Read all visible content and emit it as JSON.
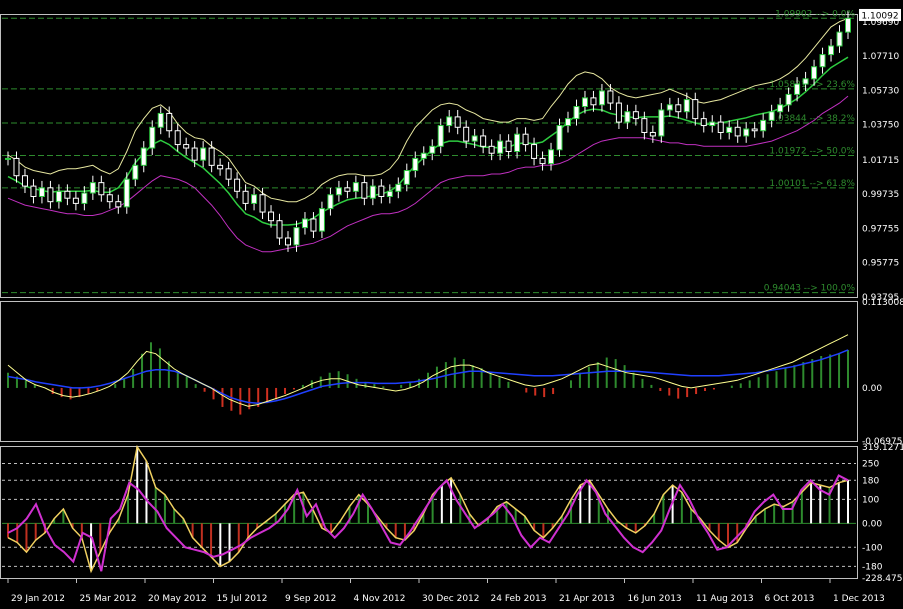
{
  "chart_data": [
    {
      "type": "line",
      "panel": "price",
      "ylim": [
        0.9379,
        1.1009
      ],
      "price_tag": "1.10092",
      "y_ticks": [
        "1.09690",
        "1.07710",
        "1.05730",
        "1.03750",
        "1.01715",
        "0.99735",
        "0.97755",
        "0.95775",
        "0.93795"
      ],
      "y_tick_values": [
        1.0969,
        1.0771,
        1.0573,
        1.0375,
        1.01715,
        0.99735,
        0.97755,
        0.95775,
        0.93795
      ],
      "fib_levels": [
        {
          "label": "1.09902 --> 0.0%",
          "value": 1.09902
        },
        {
          "label": "1.05821 --> 23.6%",
          "value": 1.05821
        },
        {
          "label": "1.03844 --> 38.2%",
          "value": 1.03844
        },
        {
          "label": "1.01972 --> 50.0%",
          "value": 1.01972
        },
        {
          "label": "1.00101 --> 61.8%",
          "value": 1.00101
        },
        {
          "label": "0.94043 --> 100.0%",
          "value": 0.94043
        }
      ],
      "close": [
        1.018,
        1.008,
        1.002,
        0.996,
        1.001,
        0.993,
        0.999,
        0.995,
        0.992,
        0.998,
        1.004,
        0.997,
        0.993,
        0.99,
        1.006,
        1.014,
        1.024,
        1.036,
        1.044,
        1.034,
        1.026,
        1.024,
        1.017,
        1.024,
        1.014,
        1.012,
        1.006,
        0.999,
        0.992,
        0.997,
        0.987,
        0.982,
        0.972,
        0.968,
        0.978,
        0.983,
        0.976,
        0.989,
        0.997,
        1.001,
        0.999,
        1.004,
        0.995,
        1.002,
        0.996,
        0.999,
        1.003,
        1.011,
        1.018,
        1.021,
        1.025,
        1.037,
        1.042,
        1.036,
        1.028,
        1.031,
        1.025,
        1.021,
        1.028,
        1.022,
        1.032,
        1.026,
        1.018,
        1.015,
        1.023,
        1.037,
        1.041,
        1.048,
        1.053,
        1.049,
        1.057,
        1.05,
        1.039,
        1.045,
        1.041,
        1.033,
        1.031,
        1.046,
        1.049,
        1.045,
        1.052,
        1.041,
        1.037,
        1.039,
        1.033,
        1.036,
        1.031,
        1.035,
        1.034,
        1.04,
        1.045,
        1.049,
        1.055,
        1.061,
        1.064,
        1.071,
        1.078,
        1.083,
        1.091,
        1.099
      ],
      "bb_upper": [
        1.02,
        1.017,
        1.013,
        1.011,
        1.01,
        1.009,
        1.011,
        1.012,
        1.012,
        1.013,
        1.014,
        1.011,
        1.009,
        1.012,
        1.022,
        1.034,
        1.041,
        1.047,
        1.049,
        1.045,
        1.038,
        1.033,
        1.03,
        1.029,
        1.025,
        1.022,
        1.018,
        1.011,
        1.004,
        1.002,
        0.998,
        0.995,
        0.994,
        0.993,
        0.993,
        0.995,
        0.998,
        1.003,
        1.006,
        1.008,
        1.009,
        1.009,
        1.008,
        1.008,
        1.009,
        1.012,
        1.018,
        1.028,
        1.036,
        1.041,
        1.046,
        1.049,
        1.05,
        1.049,
        1.046,
        1.044,
        1.041,
        1.04,
        1.039,
        1.039,
        1.041,
        1.041,
        1.04,
        1.041,
        1.048,
        1.054,
        1.061,
        1.066,
        1.068,
        1.067,
        1.064,
        1.059,
        1.056,
        1.054,
        1.053,
        1.054,
        1.055,
        1.056,
        1.058,
        1.056,
        1.054,
        1.051,
        1.05,
        1.051,
        1.052,
        1.054,
        1.056,
        1.058,
        1.06,
        1.061,
        1.062,
        1.064,
        1.067,
        1.071,
        1.076,
        1.082,
        1.088,
        1.094,
        1.097,
        1.099
      ],
      "bb_lower": [
        0.995,
        0.993,
        0.991,
        0.99,
        0.989,
        0.988,
        0.987,
        0.986,
        0.986,
        0.985,
        0.985,
        0.986,
        0.988,
        0.99,
        0.993,
        0.997,
        1.001,
        1.005,
        1.008,
        1.007,
        1.006,
        1.004,
        1.001,
        0.996,
        0.991,
        0.985,
        0.978,
        0.972,
        0.968,
        0.966,
        0.964,
        0.964,
        0.965,
        0.966,
        0.967,
        0.968,
        0.969,
        0.971,
        0.973,
        0.976,
        0.979,
        0.981,
        0.983,
        0.985,
        0.986,
        0.986,
        0.987,
        0.989,
        0.992,
        0.996,
        1.0,
        1.004,
        1.006,
        1.007,
        1.008,
        1.008,
        1.008,
        1.009,
        1.009,
        1.01,
        1.012,
        1.013,
        1.013,
        1.014,
        1.014,
        1.015,
        1.017,
        1.02,
        1.023,
        1.026,
        1.028,
        1.029,
        1.03,
        1.03,
        1.03,
        1.03,
        1.029,
        1.028,
        1.027,
        1.027,
        1.026,
        1.026,
        1.025,
        1.025,
        1.025,
        1.025,
        1.025,
        1.025,
        1.026,
        1.027,
        1.028,
        1.03,
        1.032,
        1.034,
        1.037,
        1.04,
        1.044,
        1.047,
        1.05,
        1.054
      ]
    },
    {
      "type": "bar",
      "panel": "macd",
      "ylim": [
        -0.069754,
        0.113008
      ],
      "y_ticks": [
        "0.113008",
        "0.00",
        "-0.069754"
      ],
      "y_tick_values": [
        0.113008,
        0.0,
        -0.069754
      ],
      "histogram": [
        0.02,
        0.015,
        0.01,
        0.005,
        0.0,
        -0.008,
        -0.012,
        -0.015,
        -0.012,
        -0.008,
        -0.004,
        0.0,
        0.005,
        0.012,
        0.025,
        0.045,
        0.06,
        0.052,
        0.035,
        0.022,
        0.015,
        0.005,
        -0.005,
        -0.015,
        -0.025,
        -0.03,
        -0.035,
        -0.028,
        -0.025,
        -0.02,
        -0.015,
        -0.008,
        -0.002,
        0.004,
        0.01,
        0.015,
        0.02,
        0.022,
        0.018,
        0.012,
        0.008,
        0.005,
        0.002,
        0.0,
        0.004,
        0.008,
        0.012,
        0.02,
        0.028,
        0.034,
        0.04,
        0.038,
        0.03,
        0.026,
        0.02,
        0.014,
        0.008,
        0.0,
        -0.006,
        -0.01,
        -0.012,
        -0.008,
        0.0,
        0.01,
        0.02,
        0.028,
        0.034,
        0.04,
        0.038,
        0.03,
        0.02,
        0.012,
        0.004,
        -0.004,
        -0.01,
        -0.014,
        -0.012,
        -0.008,
        -0.004,
        -0.002,
        0.0,
        0.003,
        0.006,
        0.01,
        0.014,
        0.018,
        0.022,
        0.026,
        0.03,
        0.034,
        0.038,
        0.042,
        0.044,
        0.046,
        0.05
      ],
      "macd_line": [
        0.03,
        0.02,
        0.01,
        0.004,
        0.0,
        -0.006,
        -0.01,
        -0.012,
        -0.01,
        -0.007,
        -0.003,
        0.002,
        0.01,
        0.02,
        0.035,
        0.048,
        0.045,
        0.035,
        0.025,
        0.018,
        0.012,
        0.006,
        0.0,
        -0.008,
        -0.015,
        -0.02,
        -0.024,
        -0.022,
        -0.018,
        -0.014,
        -0.01,
        -0.005,
        0.0,
        0.006,
        0.01,
        0.012,
        0.012,
        0.008,
        0.004,
        0.002,
        0.0,
        -0.002,
        -0.004,
        -0.002,
        0.002,
        0.008,
        0.016,
        0.022,
        0.028,
        0.03,
        0.03,
        0.026,
        0.02,
        0.016,
        0.012,
        0.008,
        0.004,
        0.002,
        0.004,
        0.008,
        0.012,
        0.018,
        0.024,
        0.03,
        0.032,
        0.028,
        0.024,
        0.02,
        0.018,
        0.016,
        0.014,
        0.01,
        0.006,
        0.002,
        0.0,
        0.002,
        0.004,
        0.006,
        0.008,
        0.01,
        0.014,
        0.018,
        0.022,
        0.026,
        0.03,
        0.034,
        0.04,
        0.046,
        0.052,
        0.058,
        0.064,
        0.07
      ],
      "signal_line": [
        0.015,
        0.013,
        0.011,
        0.008,
        0.006,
        0.004,
        0.002,
        0.0,
        0.0,
        0.001,
        0.003,
        0.006,
        0.01,
        0.014,
        0.018,
        0.022,
        0.024,
        0.024,
        0.022,
        0.018,
        0.012,
        0.006,
        0.0,
        -0.006,
        -0.012,
        -0.016,
        -0.019,
        -0.02,
        -0.019,
        -0.017,
        -0.014,
        -0.01,
        -0.006,
        -0.002,
        0.002,
        0.004,
        0.006,
        0.007,
        0.007,
        0.007,
        0.006,
        0.006,
        0.006,
        0.007,
        0.008,
        0.01,
        0.012,
        0.015,
        0.018,
        0.02,
        0.022,
        0.022,
        0.021,
        0.02,
        0.019,
        0.018,
        0.017,
        0.016,
        0.016,
        0.016,
        0.017,
        0.018,
        0.019,
        0.02,
        0.021,
        0.022,
        0.022,
        0.022,
        0.022,
        0.021,
        0.02,
        0.019,
        0.018,
        0.017,
        0.016,
        0.016,
        0.016,
        0.016,
        0.017,
        0.018,
        0.019,
        0.02,
        0.022,
        0.024,
        0.026,
        0.028,
        0.031,
        0.034,
        0.037,
        0.041,
        0.045,
        0.05
      ]
    },
    {
      "type": "bar",
      "panel": "cci",
      "ylim": [
        -228.475,
        319.1271
      ],
      "y_ticks": [
        "319.1271",
        "250",
        "180",
        "100",
        "0.00",
        "-100",
        "-180",
        "-228.475"
      ],
      "y_tick_values": [
        319.1271,
        250,
        180,
        100,
        0,
        -100,
        -180,
        -228.475
      ],
      "x_labels": [
        "29 Jan 2012",
        "25 Mar 2012",
        "20 May 2012",
        "15 Jul 2012",
        "9 Sep 2012",
        "4 Nov 2012",
        "30 Dec 2012",
        "24 Feb 2013",
        "21 Apr 2013",
        "16 Jun 2013",
        "11 Aug 2013",
        "6 Oct 2013",
        "1 Dec 2013"
      ],
      "cci": [
        -60,
        -80,
        -120,
        -70,
        -40,
        20,
        60,
        -20,
        -60,
        -200,
        -120,
        -40,
        20,
        120,
        320,
        260,
        150,
        120,
        60,
        20,
        -60,
        -100,
        -140,
        -180,
        -160,
        -120,
        -60,
        -20,
        10,
        40,
        80,
        120,
        130,
        60,
        -20,
        -40,
        10,
        70,
        120,
        80,
        30,
        -20,
        -60,
        -70,
        -30,
        40,
        120,
        160,
        190,
        120,
        40,
        -10,
        20,
        70,
        90,
        60,
        30,
        -30,
        -60,
        -20,
        30,
        100,
        160,
        180,
        120,
        60,
        10,
        -20,
        -40,
        -10,
        40,
        120,
        160,
        130,
        60,
        20,
        -30,
        -70,
        -100,
        -80,
        -20,
        30,
        60,
        80,
        70,
        90,
        130,
        170,
        160,
        150,
        170,
        180
      ],
      "cci_ma": [
        -40,
        -20,
        20,
        80,
        -20,
        -90,
        -120,
        -160,
        -40,
        -60,
        -200,
        20,
        60,
        170,
        140,
        90,
        50,
        -20,
        -60,
        -100,
        -110,
        -120,
        -140,
        -130,
        -110,
        -90,
        -60,
        -40,
        -20,
        10,
        60,
        140,
        30,
        80,
        -20,
        -60,
        -20,
        40,
        120,
        60,
        -10,
        -80,
        -90,
        -40,
        20,
        80,
        140,
        180,
        100,
        40,
        -20,
        10,
        40,
        80,
        30,
        -50,
        -100,
        -60,
        -80,
        -20,
        40,
        120,
        180,
        130,
        40,
        -10,
        -60,
        -100,
        -120,
        -80,
        -30,
        70,
        160,
        100,
        20,
        -40,
        -110,
        -100,
        -60,
        -20,
        50,
        90,
        120,
        60,
        60,
        140,
        180,
        140,
        120,
        200,
        180
      ]
    }
  ]
}
